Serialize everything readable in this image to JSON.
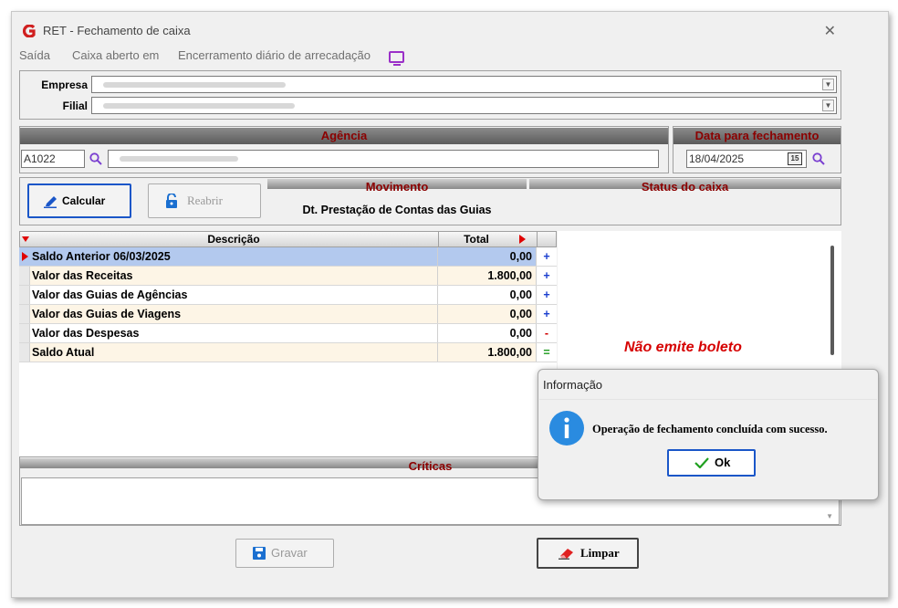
{
  "window": {
    "title": "RET - Fechamento de caixa"
  },
  "menu": [
    "Saída",
    "Caixa aberto em",
    "Encerramento diário de arrecadação"
  ],
  "empresa_label": "Empresa",
  "filial_label": "Filial",
  "agencia": {
    "header": "Agência",
    "code": "A1022"
  },
  "data_fechamento": {
    "header": "Data para fechamento",
    "value": "18/04/2025",
    "calendar_badge": "15"
  },
  "buttons": {
    "calcular": "Calcular",
    "reabrir": "Reabrir",
    "gravar": "Gravar",
    "limpar": "Limpar"
  },
  "movimento": {
    "header": "Movimento",
    "value": "Dt. Prestação de Contas das Guias"
  },
  "status": {
    "header": "Status do caixa"
  },
  "grid": {
    "col_desc": "Descrição",
    "col_total": "Total",
    "rows": [
      {
        "desc": "Saldo Anterior  06/03/2025",
        "total": "0,00",
        "sign": "+"
      },
      {
        "desc": "Valor das Receitas",
        "total": "1.800,00",
        "sign": "+"
      },
      {
        "desc": "Valor das Guias de Agências",
        "total": "0,00",
        "sign": "+"
      },
      {
        "desc": "Valor das Guias de Viagens",
        "total": "0,00",
        "sign": "+"
      },
      {
        "desc": "Valor das Despesas",
        "total": "0,00",
        "sign": "-"
      },
      {
        "desc": "Saldo Atual",
        "total": "1.800,00",
        "sign": "="
      }
    ]
  },
  "criticas": {
    "header": "Críticas"
  },
  "annotation": "Não emite boleto",
  "dialog": {
    "title": "Informação",
    "message": "Operação de fechamento concluída com sucesso.",
    "ok": "Ok"
  },
  "colors": {
    "header_text": "#8b0000",
    "selected_row": "#b3c9ee",
    "plus": "#1a3fcf",
    "minus": "#d00000",
    "equals": "#1a9a1a",
    "annotation": "#d60000"
  }
}
